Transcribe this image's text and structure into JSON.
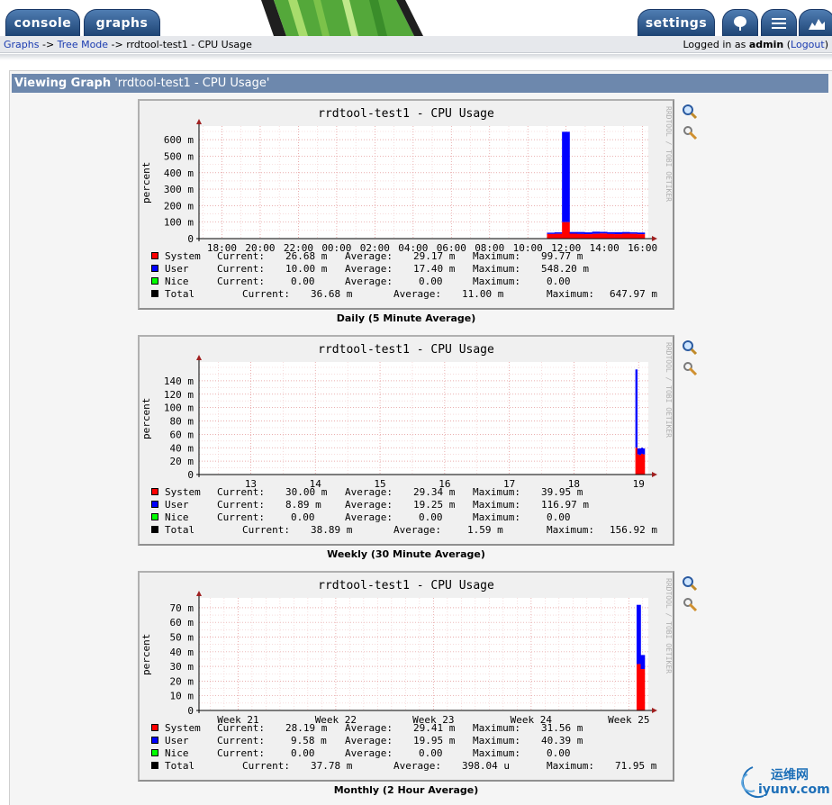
{
  "tabs": {
    "console": "console",
    "graphs": "graphs",
    "settings": "settings"
  },
  "breadcrumb": {
    "graphs": "Graphs",
    "sep1": " -> ",
    "tree": "Tree Mode",
    "sep2": " -> ",
    "current": "rrdtool-test1 - CPU Usage"
  },
  "login": {
    "prefix": "Logged in as ",
    "user": "admin",
    "open": " (",
    "logout": "Logout",
    "close": ")"
  },
  "view_header": {
    "label": "Viewing Graph",
    "name": "'rrdtool-test1 - CPU Usage'"
  },
  "side_text": "RRDTOOL / TOBI OETIKER",
  "watermark": {
    "cn": "运维网",
    "en": "iyunv.com"
  },
  "legend_labels": {
    "current": "Current:",
    "average": "Average:",
    "maximum": "Maximum:"
  },
  "colors": {
    "system": "#ff0000",
    "user": "#0000ff",
    "nice": "#00ff00",
    "total": "#000000",
    "tab": "#2b5a92",
    "header": "#6d88ad"
  },
  "graphs": [
    {
      "title": "rrdtool-test1 - CPU Usage",
      "caption": "Daily (5 Minute Average)",
      "legend": [
        {
          "name": "System",
          "current": "26.68 m",
          "average": "29.17 m",
          "maximum": "99.77 m"
        },
        {
          "name": "User",
          "current": "10.00 m",
          "average": "17.40 m",
          "maximum": "548.20 m"
        },
        {
          "name": "Nice",
          "current": "0.00",
          "average": "0.00",
          "maximum": "0.00"
        },
        {
          "name": "Total",
          "current": "36.68 m",
          "average": "11.00 m",
          "maximum": "647.97 m"
        }
      ]
    },
    {
      "title": "rrdtool-test1 - CPU Usage",
      "caption": "Weekly (30 Minute Average)",
      "legend": [
        {
          "name": "System",
          "current": "30.00 m",
          "average": "29.34 m",
          "maximum": "39.95 m"
        },
        {
          "name": "User",
          "current": "8.89 m",
          "average": "19.25 m",
          "maximum": "116.97 m"
        },
        {
          "name": "Nice",
          "current": "0.00",
          "average": "0.00",
          "maximum": "0.00"
        },
        {
          "name": "Total",
          "current": "38.89 m",
          "average": "1.59 m",
          "maximum": "156.92 m"
        }
      ]
    },
    {
      "title": "rrdtool-test1 - CPU Usage",
      "caption": "Monthly (2 Hour Average)",
      "legend": [
        {
          "name": "System",
          "current": "28.19 m",
          "average": "29.41 m",
          "maximum": "31.56 m"
        },
        {
          "name": "User",
          "current": "9.58 m",
          "average": "19.95 m",
          "maximum": "40.39 m"
        },
        {
          "name": "Nice",
          "current": "0.00",
          "average": "0.00",
          "maximum": "0.00"
        },
        {
          "name": "Total",
          "current": "37.78 m",
          "average": "398.04 u",
          "maximum": "71.95 m"
        }
      ]
    }
  ],
  "chart_data": [
    {
      "type": "area",
      "title": "rrdtool-test1 - CPU Usage",
      "ylabel": "percent",
      "ylim": [
        0,
        650
      ],
      "yticks": [
        "0",
        "100 m",
        "200 m",
        "300 m",
        "400 m",
        "500 m",
        "600 m"
      ],
      "yvalues": [
        0,
        100,
        200,
        300,
        400,
        500,
        600
      ],
      "xticks": [
        "18:00",
        "20:00",
        "22:00",
        "00:00",
        "02:00",
        "04:00",
        "06:00",
        "08:00",
        "10:00",
        "12:00",
        "14:00",
        "16:00"
      ],
      "xticks_hours": [
        18,
        20,
        22,
        24,
        26,
        28,
        30,
        32,
        34,
        36,
        38,
        40
      ],
      "xlim_hours": [
        16.8,
        40.3
      ],
      "data_start_hours": 35.0,
      "series": [
        {
          "name": "System",
          "values": [
            28,
            29,
            99.77,
            30,
            28,
            27,
            29,
            31,
            28,
            27,
            30,
            29,
            26.68
          ]
        },
        {
          "name": "User",
          "values": [
            8,
            9,
            548.2,
            10,
            12,
            11,
            13,
            10,
            11,
            12,
            10,
            9,
            10
          ]
        }
      ],
      "legend_position": "bottom",
      "grid": true
    },
    {
      "type": "area",
      "title": "rrdtool-test1 - CPU Usage",
      "ylabel": "percent",
      "ylim": [
        0,
        160
      ],
      "yticks": [
        "0",
        "20 m",
        "40 m",
        "60 m",
        "80 m",
        "100 m",
        "120 m",
        "140 m"
      ],
      "yvalues": [
        0,
        20,
        40,
        60,
        80,
        100,
        120,
        140
      ],
      "xticks": [
        "13",
        "14",
        "15",
        "16",
        "17",
        "18",
        "19"
      ],
      "xticks_days": [
        13,
        14,
        15,
        16,
        17,
        18,
        19
      ],
      "xlim_days": [
        12.2,
        19.15
      ],
      "data_start_days": 18.95,
      "series": [
        {
          "name": "System",
          "values": [
            39.95,
            30,
            29,
            31,
            30
          ]
        },
        {
          "name": "User",
          "values": [
            116.97,
            9,
            10,
            9,
            8.89
          ]
        }
      ],
      "legend_position": "bottom",
      "grid": true
    },
    {
      "type": "area",
      "title": "rrdtool-test1 - CPU Usage",
      "ylabel": "percent",
      "ylim": [
        0,
        73
      ],
      "yticks": [
        "0",
        "10 m",
        "20 m",
        "30 m",
        "40 m",
        "50 m",
        "60 m",
        "70 m"
      ],
      "yvalues": [
        0,
        10,
        20,
        30,
        40,
        50,
        60,
        70
      ],
      "xticks": [
        "Week 21",
        "Week 22",
        "Week 23",
        "Week 24",
        "Week 25"
      ],
      "xticks_weeks": [
        21,
        22,
        23,
        24,
        25
      ],
      "xlim_weeks": [
        20.6,
        25.2
      ],
      "data_start_weeks": 25.08,
      "series": [
        {
          "name": "System",
          "values": [
            31.56,
            28.19
          ]
        },
        {
          "name": "User",
          "values": [
            40.39,
            9.58
          ]
        }
      ],
      "legend_position": "bottom",
      "grid": true
    }
  ]
}
